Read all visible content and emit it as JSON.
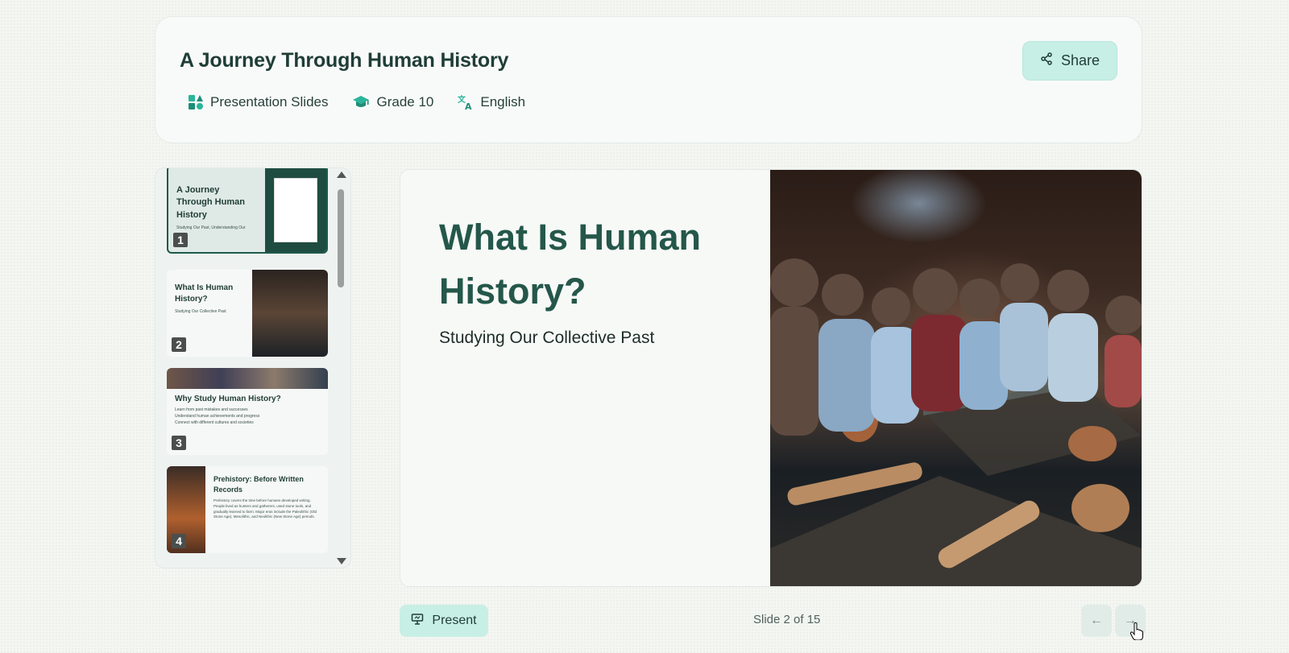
{
  "header": {
    "title": "A Journey Through Human History",
    "share_label": "Share",
    "meta": [
      {
        "icon": "slides-icon",
        "label": "Presentation Slides"
      },
      {
        "icon": "graduation-cap-icon",
        "label": "Grade 10"
      },
      {
        "icon": "translate-icon",
        "label": "English"
      }
    ]
  },
  "sidebar": {
    "thumbnails": [
      {
        "number": "1",
        "title": "A Journey Through Human History",
        "subtitle": "Studying Our Past, Understanding Our",
        "active": true
      },
      {
        "number": "2",
        "title": "What Is Human History?",
        "subtitle": "Studying Our Collective Past",
        "active": false
      },
      {
        "number": "3",
        "title": "Why Study Human History?",
        "bullets": [
          "Learn from past mistakes and successes",
          "Understand human achievements and progress",
          "Connect with different cultures and societies"
        ],
        "active": false
      },
      {
        "number": "4",
        "title": "Prehistory: Before Written Records",
        "body": "Prehistory covers the time before humans developed writing. People lived as hunters and gatherers, used stone tools, and gradually learned to farm. Major eras include the Paleolithic (Old Stone Age), Mesolithic, and Neolithic (New Stone Age) periods.",
        "active": false
      }
    ]
  },
  "slide": {
    "title": "What Is Human History?",
    "subtitle": "Studying Our Collective Past"
  },
  "footer": {
    "present_label": "Present",
    "counter": "Slide 2 of 15",
    "prev_glyph": "←",
    "next_glyph": "→"
  },
  "colors": {
    "accent": "#c8efe5",
    "title_green": "#24574a",
    "active_border": "#1e5a4c"
  }
}
